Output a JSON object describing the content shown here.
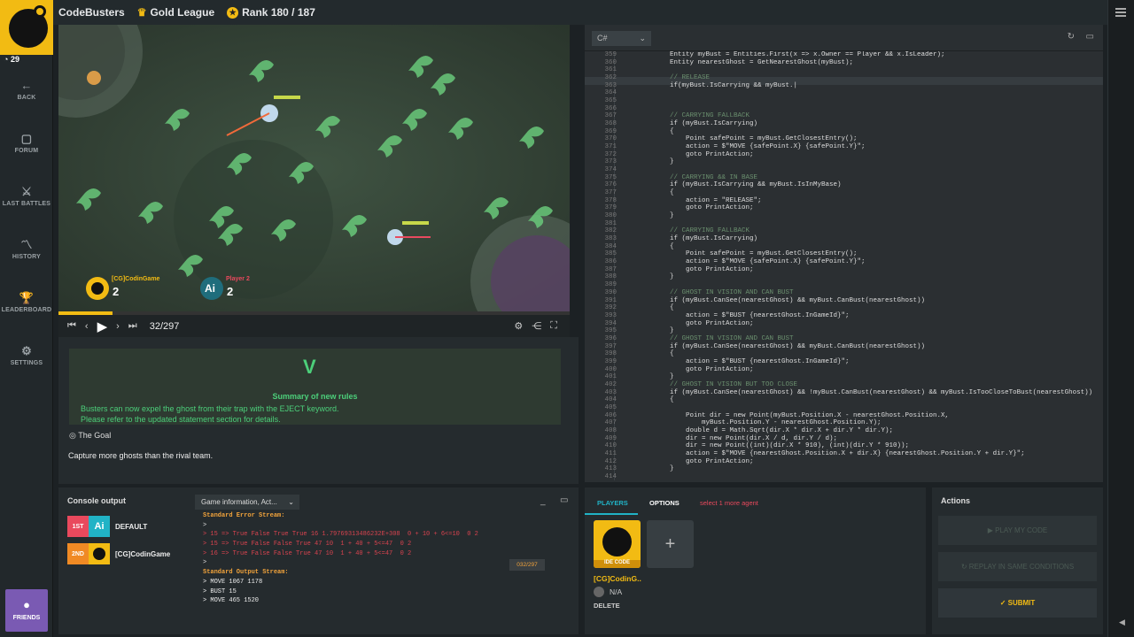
{
  "sidebar": {
    "level": "29",
    "items": [
      {
        "label": "BACK",
        "icon": "←"
      },
      {
        "label": "FORUM",
        "icon": "▢"
      },
      {
        "label": "LAST BATTLES",
        "icon": "⚔"
      },
      {
        "label": "HISTORY",
        "icon": "〽"
      },
      {
        "label": "LEADERBOARD",
        "icon": "🏆"
      },
      {
        "label": "SETTINGS",
        "icon": "⚙"
      }
    ],
    "friends_label": "FRIENDS"
  },
  "topbar": {
    "title": "CodeBusters",
    "league": "Gold League",
    "rank": "Rank 180 / 187"
  },
  "game": {
    "player1_name": "[CG]CodinGame",
    "player1_score": "2",
    "player2_name": "Player 2",
    "player2_score": "2",
    "ai_label": "Ai"
  },
  "player_controls": {
    "frame": "32/297",
    "progress": 0.105
  },
  "info": {
    "rules_title": "Summary of new rules",
    "rules_line1": "Busters can now expel the ghost from their trap with the EJECT keyword.",
    "rules_line2": "Please refer to the updated statement section for details.",
    "goal_title": "The Goal",
    "goal_desc": "Capture more ghosts than the rival team."
  },
  "editor": {
    "language": "C#",
    "first_line": 359,
    "lines": [
      "            Entity myBust = Entities.First(x => x.Owner == Player && x.IsLeader);",
      "            Entity nearestGhost = GetNearestGhost(myBust);",
      "",
      "            // RELEASE",
      "            if(myBust.IsCarrying && myBust.|",
      "",
      "",
      "",
      "            // CARRYING FALLBACK",
      "            if (myBust.IsCarrying)",
      "            {",
      "                Point safePoint = myBust.GetClosestEntry();",
      "                action = $\"MOVE {safePoint.X} {safePoint.Y}\";",
      "                goto PrintAction;",
      "            }",
      "",
      "            // CARRYING && IN BASE",
      "            if (myBust.IsCarrying && myBust.IsInMyBase)",
      "            {",
      "                action = \"RELEASE\";",
      "                goto PrintAction;",
      "            }",
      "",
      "            // CARRYING FALLBACK",
      "            if (myBust.IsCarrying)",
      "            {",
      "                Point safePoint = myBust.GetClosestEntry();",
      "                action = $\"MOVE {safePoint.X} {safePoint.Y}\";",
      "                goto PrintAction;",
      "            }",
      "",
      "            // GHOST IN VISION AND CAN BUST",
      "            if (myBust.CanSee(nearestGhost) && myBust.CanBust(nearestGhost))",
      "            {",
      "                action = $\"BUST {nearestGhost.InGameId}\";",
      "                goto PrintAction;",
      "            }",
      "            // GHOST IN VISION AND CAN BUST",
      "            if (myBust.CanSee(nearestGhost) && myBust.CanBust(nearestGhost))",
      "            {",
      "                action = $\"BUST {nearestGhost.InGameId}\";",
      "                goto PrintAction;",
      "            }",
      "            // GHOST IN VISION BUT TOO CLOSE",
      "            if (myBust.CanSee(nearestGhost) && !myBust.CanBust(nearestGhost) && myBust.IsTooCloseToBust(nearestGhost))",
      "            {",
      "",
      "                Point dir = new Point(myBust.Position.X - nearestGhost.Position.X,",
      "                    myBust.Position.Y - nearestGhost.Position.Y);",
      "                double d = Math.Sqrt(dir.X * dir.X + dir.Y * dir.Y);",
      "                dir = new Point(dir.X / d, dir.Y / d);",
      "                dir = new Point((int)(dir.X * 910), (int)(dir.Y * 910));",
      "                action = $\"MOVE {nearestGhost.Position.X + dir.X} {nearestGhost.Position.Y + dir.Y}\";",
      "                goto PrintAction;",
      "            }",
      ""
    ]
  },
  "console": {
    "title": "Console output",
    "dropdown": "Game information, Act...",
    "ranks": [
      {
        "place": "1ST",
        "name": "DEFAULT",
        "color": "#e9495d"
      },
      {
        "place": "2ND",
        "name": "[CG]CodinGame",
        "color": "#f08a24"
      }
    ],
    "frame_badge": "032/297",
    "lines": [
      {
        "t": "Standard Error Stream:",
        "c": "#f2a33b",
        "b": true
      },
      {
        "t": ">",
        "c": "#ddd"
      },
      {
        "t": "> 15 => True False True True 16 1.79769313486232E+308  0 + 10 + 6<=10  0 2",
        "c": "#d9434f"
      },
      {
        "t": "> 15 => True False False True 47 10  1 + 40 + 5<=47  0 2",
        "c": "#d9434f"
      },
      {
        "t": "> 16 => True False False True 47 10  1 + 40 + 5<=47  0 2",
        "c": "#d9434f"
      },
      {
        "t": ">",
        "c": "#ddd"
      },
      {
        "t": "Standard Output Stream:",
        "c": "#f2a33b",
        "b": true
      },
      {
        "t": "> MOVE 1067 1178",
        "c": "#eee"
      },
      {
        "t": "> BUST 15",
        "c": "#eee"
      },
      {
        "t": "> MOVE 465 1520",
        "c": "#eee"
      }
    ]
  },
  "players": {
    "tab_players": "PLAYERS",
    "tab_options": "OPTIONS",
    "warning": "select 1 more agent",
    "ide_label": "IDE CODE",
    "name": "[CG]CodinG..",
    "rating": "N/A",
    "delete_label": "DELETE",
    "plus": "+"
  },
  "actions": {
    "title": "Actions",
    "play": "PLAY MY CODE",
    "replay": "REPLAY IN SAME CONDITIONS",
    "submit": "SUBMIT"
  }
}
